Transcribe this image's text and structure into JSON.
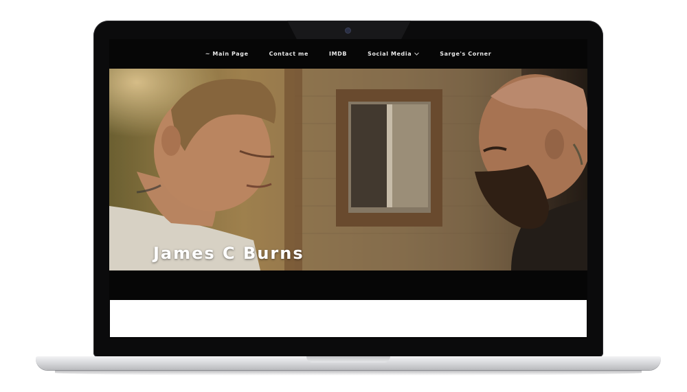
{
  "nav": {
    "items": [
      {
        "label": "~ Main Page"
      },
      {
        "label": "Contact me"
      },
      {
        "label": "IMDB"
      },
      {
        "label": "Social Media",
        "icon": "chevron-down-icon"
      },
      {
        "label": "Sarge's Corner"
      }
    ]
  },
  "hero": {
    "title": "James C Burns"
  },
  "colors": {
    "screen_bg": "#060606",
    "nav_text": "#e8e8e8",
    "hero_title": "#ffffff"
  }
}
